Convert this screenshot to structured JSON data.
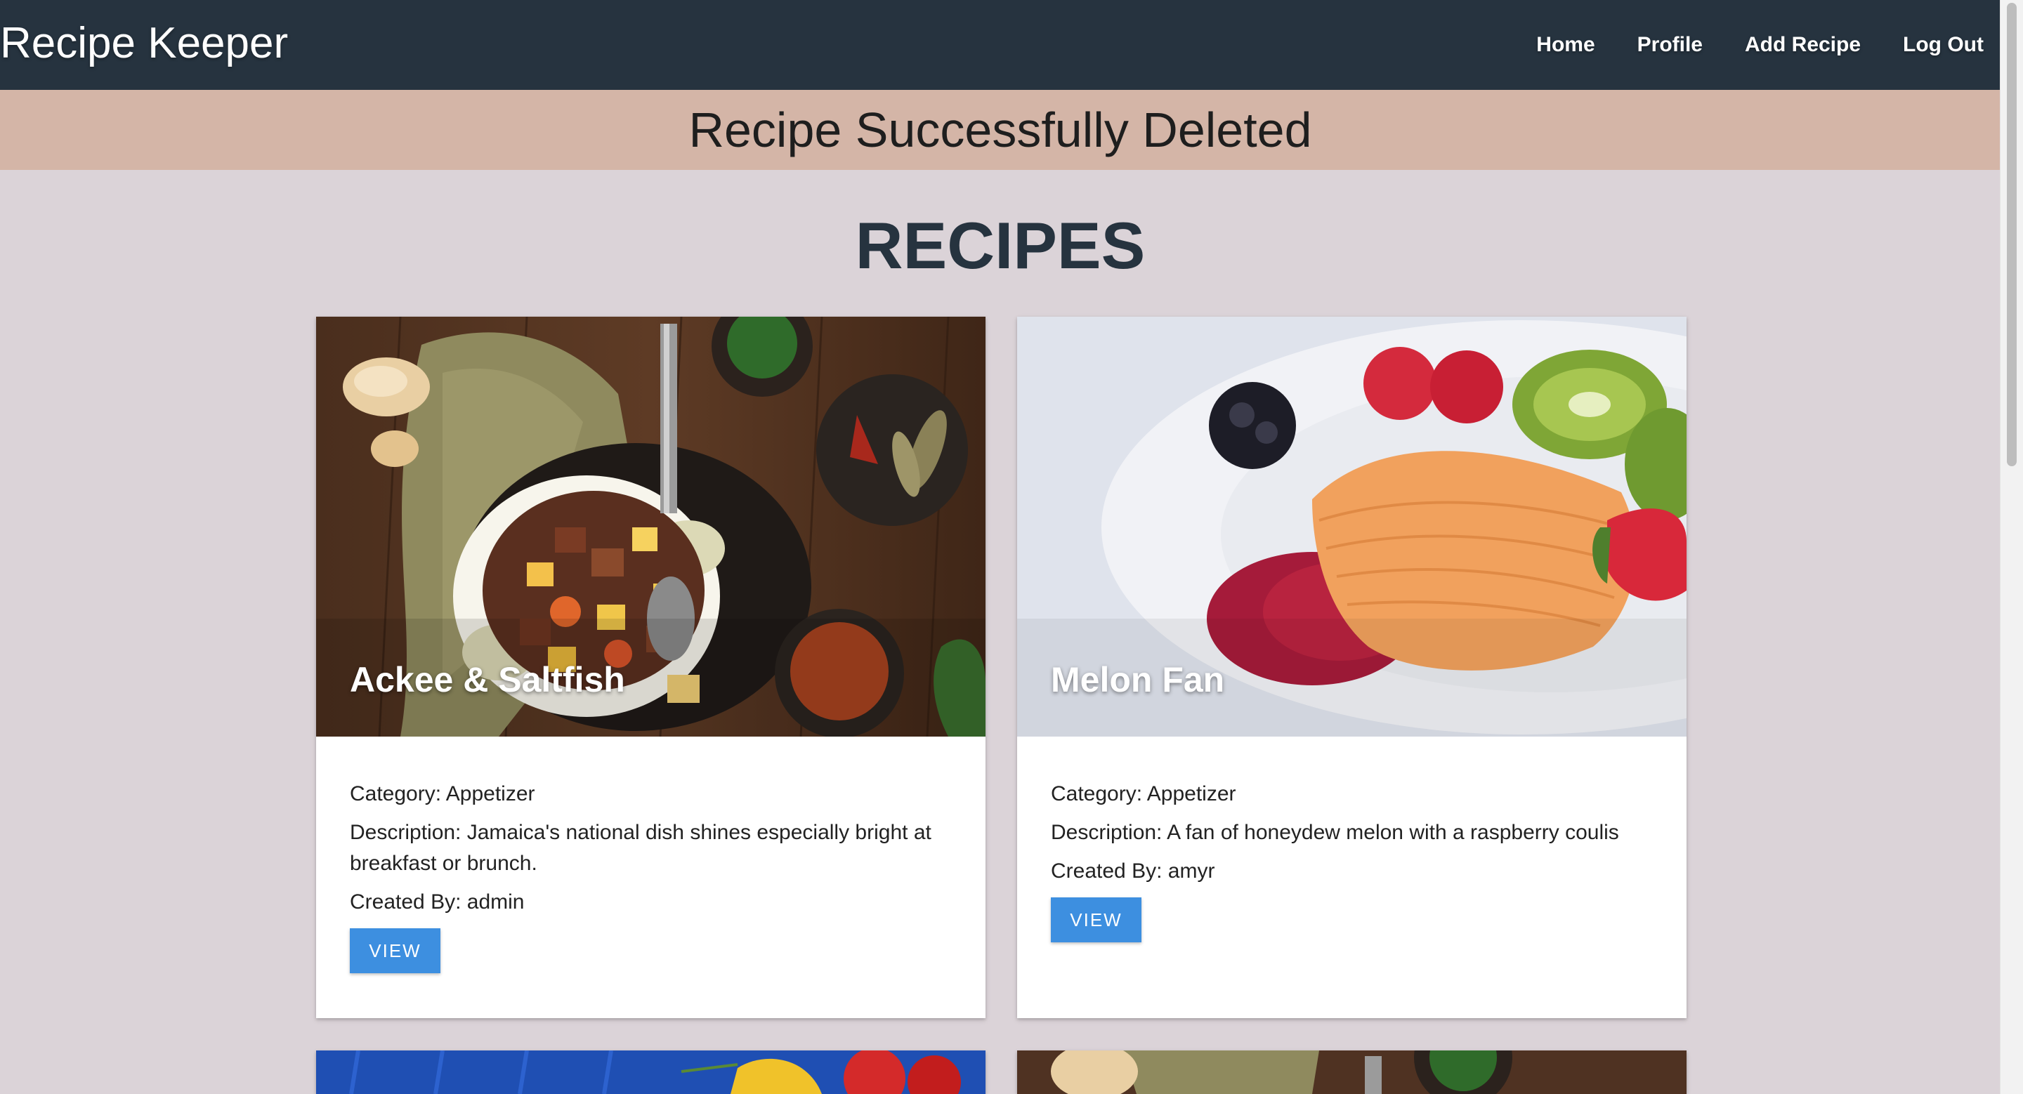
{
  "navbar": {
    "brand": "Recipe Keeper",
    "links": [
      {
        "label": "Home"
      },
      {
        "label": "Profile"
      },
      {
        "label": "Add Recipe"
      },
      {
        "label": "Log Out"
      }
    ]
  },
  "flash": {
    "message": "Recipe Successfully Deleted"
  },
  "main": {
    "title": "RECIPES"
  },
  "recipes": [
    {
      "title": "Ackee & Saltfish",
      "category_label": "Category:",
      "category": "Appetizer",
      "description_label": "Description:",
      "description": "Jamaica's national dish shines especially bright at breakfast or brunch.",
      "created_by_label": "Created By:",
      "created_by": "admin",
      "button_label": "VIEW"
    },
    {
      "title": "Melon Fan",
      "category_label": "Category:",
      "category": "Appetizer",
      "description_label": "Description:",
      "description": "A fan of honeydew melon with a raspberry coulis",
      "created_by_label": "Created By:",
      "created_by": "amyr",
      "button_label": "VIEW"
    }
  ],
  "colors": {
    "navbar": "#26333f",
    "flash": "#d4b5a7",
    "page_background": "#dbd3d8",
    "button": "#3d8fe0"
  }
}
